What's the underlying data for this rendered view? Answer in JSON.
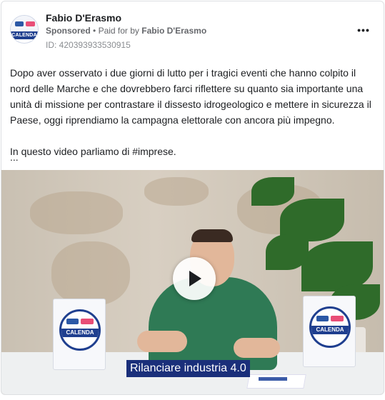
{
  "header": {
    "page_name": "Fabio D'Erasmo",
    "sponsored_label": "Sponsored",
    "separator": "•",
    "paid_for_by": "Paid for by",
    "payer": "Fabio D'Erasmo",
    "ad_id": "ID: 420393933530915",
    "avatar_text": "CALENDA",
    "more_icon": "more-horizontal-icon",
    "more_glyph": "•••"
  },
  "post": {
    "paragraph_1": "Dopo aver osservato i due giorni di lutto per i tragici eventi che hanno colpito il nord delle Marche e che dovrebbero farci riflettere su quanto sia importante una unità di missione per contrastare il dissesto idrogeologico e mettere in sicurezza il Paese, oggi riprendiamo la campagna elettorale con ancora più impegno.",
    "paragraph_2": "In questo video parliamo di #imprese.",
    "ellipsis": "..."
  },
  "video": {
    "caption": "Rilanciare industria 4.0",
    "placard_text": "CALENDA",
    "play_icon": "play-icon"
  },
  "colors": {
    "brand_blue": "#1f3f8f",
    "caption_bg": "#1a2f7a",
    "accent_pink": "#e94e77"
  }
}
